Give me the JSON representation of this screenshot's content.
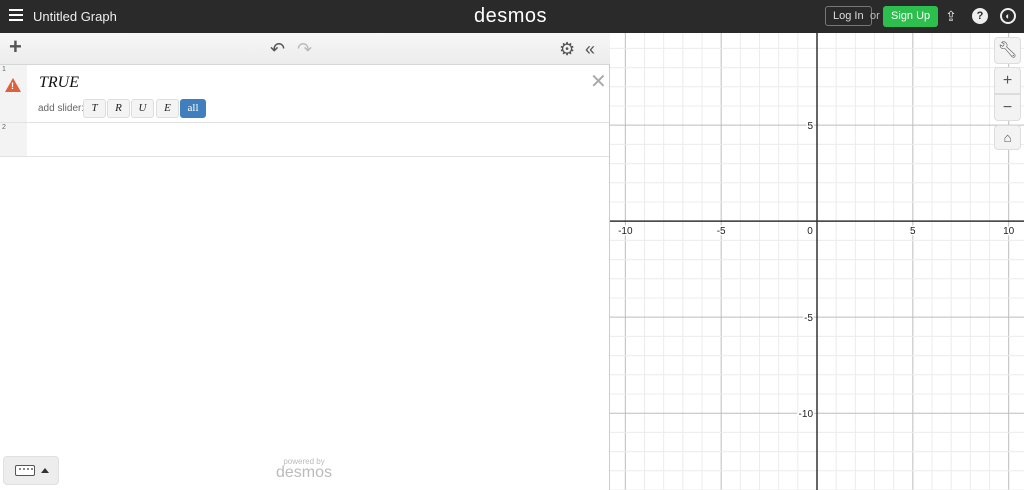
{
  "header": {
    "title": "Untitled Graph",
    "logo": "desmos",
    "login": "Log In",
    "or": "or",
    "signup": "Sign Up",
    "icons": [
      "share-icon",
      "help-icon",
      "globe-icon"
    ]
  },
  "toolbar": {
    "add": "+",
    "undo": "↶",
    "redo": "↷",
    "settings": "⚙",
    "collapse": "«"
  },
  "expressions": [
    {
      "index": "1",
      "latex": "TRUE",
      "error": true,
      "add_slider_label": "add slider:",
      "sliders": [
        "T",
        "R",
        "U",
        "E"
      ],
      "all_label": "all"
    },
    {
      "index": "2",
      "latex": ""
    }
  ],
  "footer": {
    "powered_by": "powered by",
    "brand": "desmos"
  },
  "graph_controls": {
    "wrench": "wrench-icon",
    "zoom_in": "+",
    "zoom_out": "−",
    "home": "home-icon"
  },
  "chart_data": {
    "type": "scatter",
    "xlim": [
      -10.8,
      10.8
    ],
    "ylim": [
      -14,
      9.8
    ],
    "grid": true,
    "minor_step": 1,
    "major_step": 5,
    "x_tick_labels": [
      "-10",
      "-5",
      "0",
      "5",
      "10"
    ],
    "x_ticks": [
      -10,
      -5,
      0,
      5,
      10
    ],
    "y_tick_labels": [
      "5",
      "-5",
      "-10"
    ],
    "y_ticks": [
      5,
      -5,
      -10
    ],
    "series": []
  },
  "colors": {
    "signup": "#2cbf4d",
    "accent": "#3f7fbe",
    "warning": "#e0603c"
  }
}
